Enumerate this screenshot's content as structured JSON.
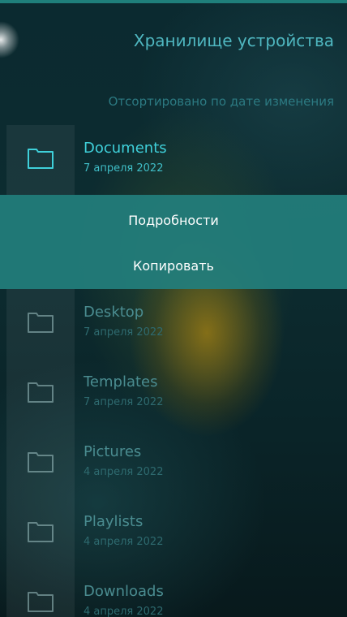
{
  "header": {
    "title": "Хранилище устройства"
  },
  "sort_label": "Отсортировано по дате изменения",
  "folders": [
    {
      "name": "Documents",
      "date": "7 апреля 2022"
    },
    {
      "name": "Desktop",
      "date": "7 апреля 2022"
    },
    {
      "name": "Templates",
      "date": "7 апреля 2022"
    },
    {
      "name": "Pictures",
      "date": "4 апреля 2022"
    },
    {
      "name": "Playlists",
      "date": "4 апреля 2022"
    },
    {
      "name": "Downloads",
      "date": "4 апреля 2022"
    }
  ],
  "context_menu": {
    "items": [
      {
        "label": "Подробности"
      },
      {
        "label": "Копировать"
      }
    ]
  },
  "icons": {
    "folder": "folder-icon"
  },
  "colors": {
    "accent": "#3fd0da",
    "menu_background": "#227e7c",
    "dim_text": "#4a8c90"
  }
}
